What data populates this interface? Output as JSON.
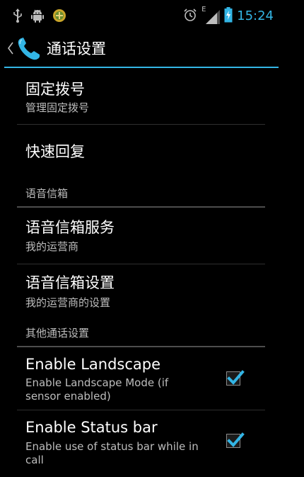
{
  "status_bar": {
    "time": "15:24",
    "network_label": "E",
    "icons": [
      "usb-icon",
      "android-debug-icon",
      "notification-app-icon",
      "alarm-icon",
      "signal-icon",
      "battery-icon"
    ]
  },
  "action_bar": {
    "title": "通话设置",
    "icon": "phone-icon"
  },
  "list": {
    "fixed_dialing": {
      "title": "固定拨号",
      "summary": "管理固定拨号"
    },
    "quick_reply": {
      "title": "快速回复"
    },
    "voicemail_category": "语音信箱",
    "voicemail_service": {
      "title": "语音信箱服务",
      "summary": "我的运营商"
    },
    "voicemail_settings": {
      "title": "语音信箱设置",
      "summary": "我的运营商的设置"
    },
    "other_category": "其他通话设置",
    "enable_landscape": {
      "title": "Enable Landscape",
      "summary_line1": "Enable Landscape Mode (if",
      "summary_line2": "sensor enabled)",
      "checked": true
    },
    "enable_status_bar": {
      "title": "Enable Status bar",
      "summary_line1": "Enable use of status bar while in",
      "summary_line2": "call",
      "checked": true
    }
  },
  "colors": {
    "accent": "#33b5e5",
    "background": "#000000",
    "text_primary": "#ffffff",
    "text_secondary": "#bdbdbd"
  }
}
